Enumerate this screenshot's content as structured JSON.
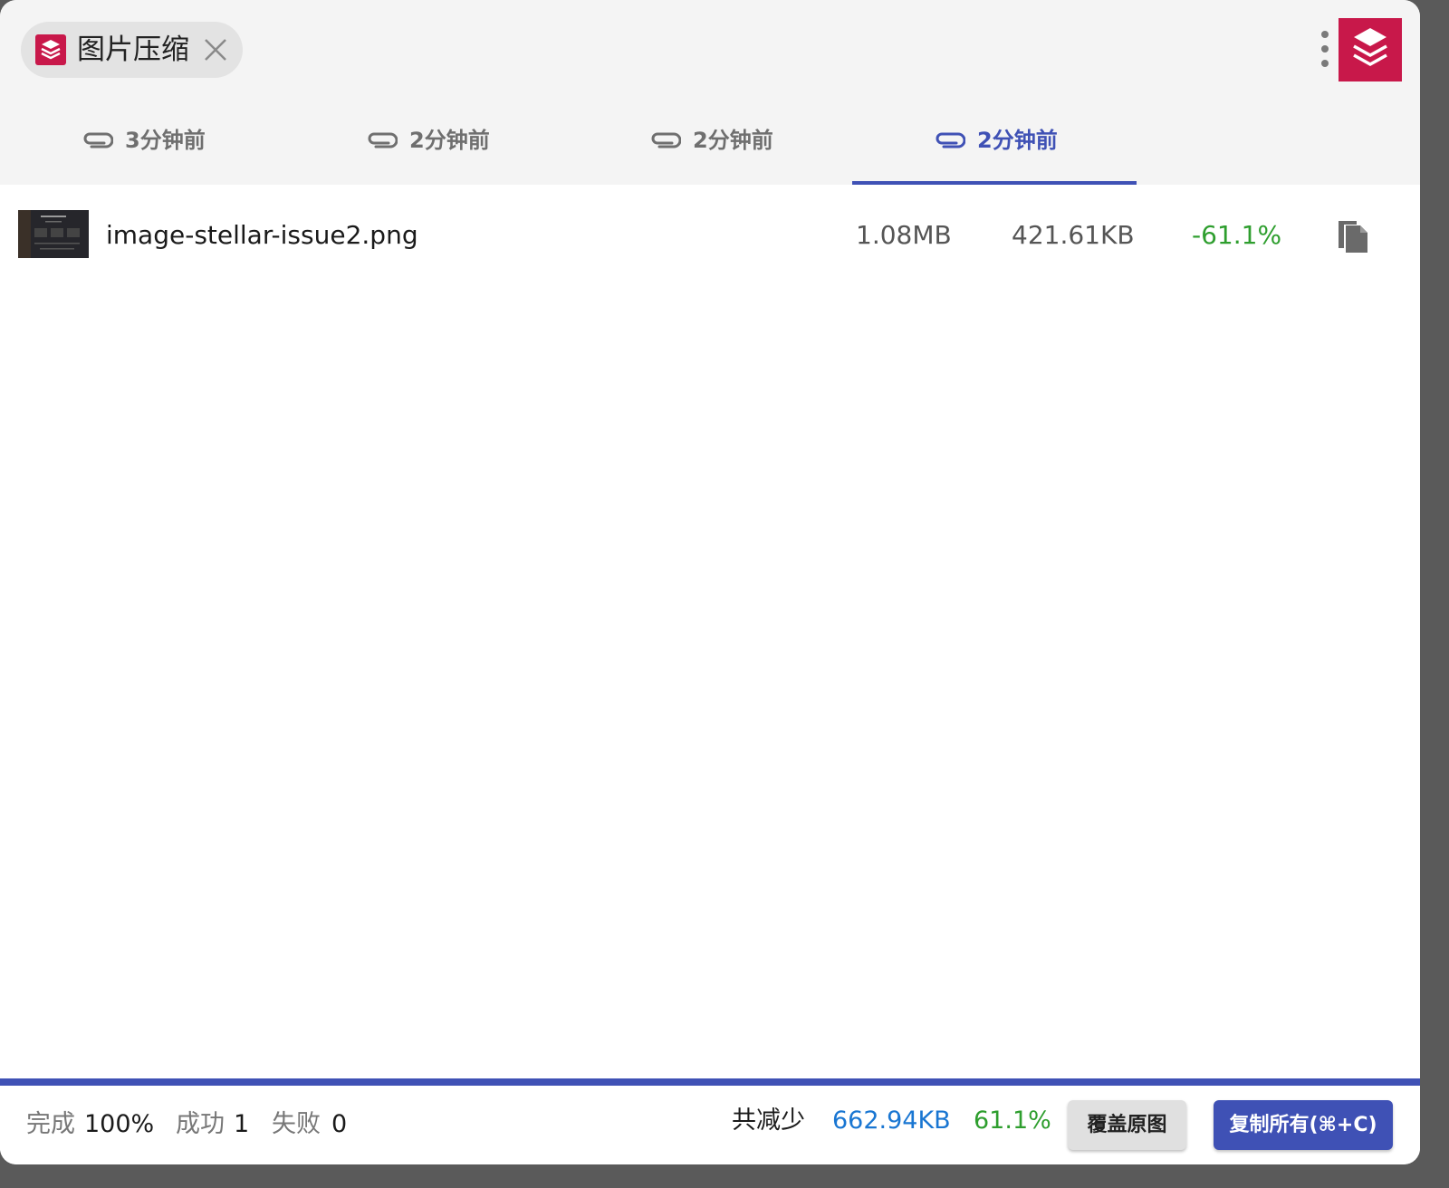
{
  "header": {
    "chip_label": "图片压缩",
    "chip_icon": "layers-icon",
    "close_icon": "close-icon",
    "menu_icon": "more-vert-icon",
    "logo_icon": "layers-icon",
    "brand_color": "#c8184a"
  },
  "tabs": [
    {
      "label": "3分钟前",
      "icon": "paperclip-icon",
      "active": false
    },
    {
      "label": "2分钟前",
      "icon": "paperclip-icon",
      "active": false
    },
    {
      "label": "2分钟前",
      "icon": "paperclip-icon",
      "active": false
    },
    {
      "label": "2分钟前",
      "icon": "paperclip-icon",
      "active": true
    }
  ],
  "accent_color": "#3f51b5",
  "files": [
    {
      "name": "image-stellar-issue2.png",
      "original_size": "1.08MB",
      "compressed_size": "421.61KB",
      "ratio": "-61.1%",
      "action_icon": "copy-file-icon"
    }
  ],
  "footer": {
    "complete_label": "完成",
    "complete_value": "100%",
    "success_label": "成功",
    "success_value": "1",
    "fail_label": "失败",
    "fail_value": "0",
    "saved_label": "共减少",
    "saved_size": "662.94KB",
    "saved_percent": "61.1%",
    "overwrite_button": "覆盖原图",
    "copy_all_button": "复制所有(⌘+C)"
  }
}
